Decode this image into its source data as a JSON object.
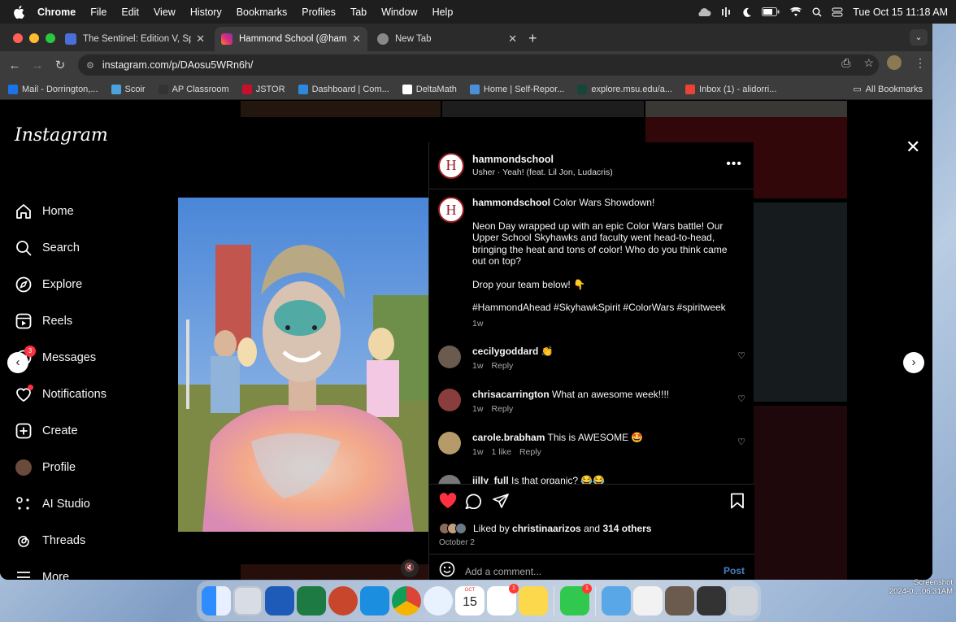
{
  "menubar": {
    "app": "Chrome",
    "items": [
      "File",
      "Edit",
      "View",
      "History",
      "Bookmarks",
      "Profiles",
      "Tab",
      "Window",
      "Help"
    ],
    "clock": "Tue Oct 15  11:18 AM"
  },
  "tabs": [
    {
      "title": "The Sentinel: Edition V, Spring",
      "color": "#4a6fd8"
    },
    {
      "title": "Hammond School (@hammond",
      "color": "#e1306c"
    },
    {
      "title": "New Tab",
      "color": "#888888"
    }
  ],
  "address": {
    "url": "instagram.com/p/DAosu5WRn6h/"
  },
  "bookmarks": [
    {
      "label": "Mail - Dorrington,...",
      "color": "#1a73e8"
    },
    {
      "label": "Scoir",
      "color": "#4aa3df"
    },
    {
      "label": "AP Classroom",
      "color": "#333333"
    },
    {
      "label": "JSTOR",
      "color": "#c8102e"
    },
    {
      "label": "Dashboard | Com...",
      "color": "#2b8ae0"
    },
    {
      "label": "DeltaMath",
      "color": "#ffffff"
    },
    {
      "label": "Home | Self-Repor...",
      "color": "#4a90d9"
    },
    {
      "label": "explore.msu.edu/a...",
      "color": "#18453b"
    },
    {
      "label": "Inbox (1) - alidorri...",
      "color": "#ea4335"
    }
  ],
  "all_bookmarks": "All Bookmarks",
  "instagram": {
    "logo": "Instagram",
    "nav": [
      {
        "label": "Home",
        "icon": "home-icon"
      },
      {
        "label": "Search",
        "icon": "search-icon"
      },
      {
        "label": "Explore",
        "icon": "compass-icon"
      },
      {
        "label": "Reels",
        "icon": "reels-icon"
      },
      {
        "label": "Messages",
        "icon": "messenger-icon",
        "badge": "3"
      },
      {
        "label": "Notifications",
        "icon": "heart-icon"
      },
      {
        "label": "Create",
        "icon": "plus-square-icon"
      },
      {
        "label": "Profile",
        "icon": "avatar"
      },
      {
        "label": "AI Studio",
        "icon": "ai-studio-icon"
      },
      {
        "label": "Threads",
        "icon": "threads-icon"
      },
      {
        "label": "More",
        "icon": "menu-icon"
      }
    ],
    "post": {
      "username": "hammondschool",
      "avatar_letter": "H",
      "song": "Usher · Yeah! (feat. Lil Jon, Ludacris)",
      "caption_head": "Color Wars Showdown!",
      "caption_p1": "Neon Day wrapped up with an epic Color Wars battle! Our Upper School Skyhawks and faculty went head-to-head, bringing the heat and tons of color! Who do you think came out on top?",
      "caption_p2": "Drop your team below! 👇",
      "caption_tags": "#HammondAhead #SkyhawkSpirit #ColorWars #spiritweek",
      "caption_age": "1w",
      "comments": [
        {
          "user": "cecilygoddard",
          "text": "👏",
          "age": "1w",
          "likes": "",
          "reply": "Reply",
          "color": "#6b5a4e"
        },
        {
          "user": "chrisacarrington",
          "text": "What an awesome week!!!!",
          "age": "1w",
          "likes": "",
          "reply": "Reply",
          "color": "#8a3d3d"
        },
        {
          "user": "carole.brabham",
          "text": "This is AWESOME 🤩",
          "age": "1w",
          "likes": "1 like",
          "reply": "Reply",
          "color": "#b59a6a"
        },
        {
          "user": "jilly_full",
          "text": "Is that organic? 😂😂",
          "age": "",
          "likes": "",
          "reply": "",
          "color": "#777777"
        }
      ],
      "liked_by_user": "christinaarizos",
      "liked_others": "314 others",
      "date": "October 2",
      "add_comment_placeholder": "Add a comment...",
      "post_label": "Post"
    }
  },
  "desktop": {
    "screenshot_label": "Screenshot",
    "screenshot_date": "2024-0....06.31AM"
  },
  "dock": {
    "calendar_month": "OCT",
    "calendar_day": "15",
    "reminders_badge": "1",
    "messages_badge": "1"
  }
}
